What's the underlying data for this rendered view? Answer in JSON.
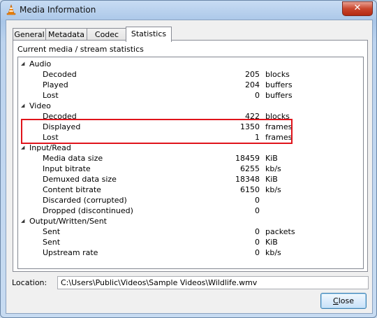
{
  "window": {
    "title": "Media Information",
    "close_glyph": "✕"
  },
  "tabs": [
    {
      "label": "General"
    },
    {
      "label": "Metadata"
    },
    {
      "label": "Codec"
    },
    {
      "label": "Statistics"
    }
  ],
  "active_tab": "Statistics",
  "stats_group_label": "Current media / stream statistics",
  "tree": {
    "audio": {
      "label": "Audio",
      "rows": [
        {
          "label": "Decoded",
          "value": "205",
          "unit": "blocks"
        },
        {
          "label": "Played",
          "value": "204",
          "unit": "buffers"
        },
        {
          "label": "Lost",
          "value": "0",
          "unit": "buffers"
        }
      ]
    },
    "video": {
      "label": "Video",
      "rows": [
        {
          "label": "Decoded",
          "value": "422",
          "unit": "blocks"
        },
        {
          "label": "Displayed",
          "value": "1350",
          "unit": "frames"
        },
        {
          "label": "Lost",
          "value": "1",
          "unit": "frames"
        }
      ]
    },
    "input": {
      "label": "Input/Read",
      "rows": [
        {
          "label": "Media data size",
          "value": "18459",
          "unit": "KiB"
        },
        {
          "label": "Input bitrate",
          "value": "6255",
          "unit": "kb/s"
        },
        {
          "label": "Demuxed data size",
          "value": "18348",
          "unit": "KiB"
        },
        {
          "label": "Content bitrate",
          "value": "6150",
          "unit": "kb/s"
        },
        {
          "label": "Discarded (corrupted)",
          "value": "0",
          "unit": ""
        },
        {
          "label": "Dropped (discontinued)",
          "value": "0",
          "unit": ""
        }
      ]
    },
    "output": {
      "label": "Output/Written/Sent",
      "rows": [
        {
          "label": "Sent",
          "value": "0",
          "unit": "packets"
        },
        {
          "label": "Sent",
          "value": "0",
          "unit": "KiB"
        },
        {
          "label": "Upstream rate",
          "value": "0",
          "unit": "kb/s"
        }
      ]
    }
  },
  "location": {
    "label": "Location:",
    "value": "C:\\Users\\Public\\Videos\\Sample Videos\\Wildlife.wmv"
  },
  "close_button": {
    "label_underlined": "C",
    "label_rest": "lose"
  },
  "colors": {
    "highlight_box": "#e0141b",
    "close_button_red": "#c9462d"
  },
  "icons": {
    "app": "vlc-cone-icon",
    "expander": "triangle-expanded-icon"
  }
}
